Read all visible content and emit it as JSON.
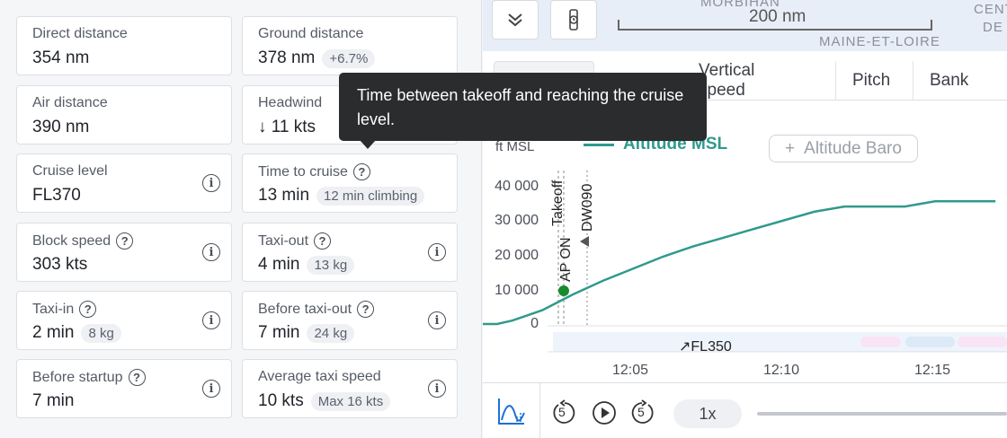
{
  "cards": {
    "direct_distance": {
      "label": "Direct distance",
      "value": "354 nm"
    },
    "ground_distance": {
      "label": "Ground distance",
      "value": "378 nm",
      "badge": "+6.7%"
    },
    "air_distance": {
      "label": "Air distance",
      "value": "390 nm"
    },
    "headwind": {
      "label": "Headwind",
      "value": "↓ 11 kts"
    },
    "cruise_level": {
      "label": "Cruise level",
      "value": "FL370"
    },
    "time_to_cruise": {
      "label": "Time to cruise",
      "value": "13 min",
      "badge": "12 min climbing"
    },
    "block_speed": {
      "label": "Block speed",
      "value": "303 kts"
    },
    "taxi_out": {
      "label": "Taxi-out",
      "value": "4 min",
      "badge": "13 kg"
    },
    "taxi_in": {
      "label": "Taxi-in",
      "value": "2 min",
      "badge": "8 kg"
    },
    "before_taxi_out": {
      "label": "Before taxi-out",
      "value": "7 min",
      "badge": "24 kg"
    },
    "before_startup": {
      "label": "Before startup",
      "value": "7 min"
    },
    "average_taxi_speed": {
      "label": "Average taxi speed",
      "value": "10 kts",
      "badge": "Max 16 kts"
    }
  },
  "tooltip": {
    "text": "Time between takeoff and reaching the cruise level."
  },
  "map": {
    "scale": "200 nm",
    "labels": [
      "MORBIHAN",
      "MAINE-ET-LOIRE",
      "CENT",
      "DE"
    ]
  },
  "tabs": [
    "",
    "Vertical speed",
    "Pitch",
    "Bank"
  ],
  "chart": {
    "y_title": "ft MSL",
    "legend_active": "Altitude MSL",
    "legend_inactive": "Altitude Baro",
    "events": [
      "Takeoff",
      "AP ON",
      "DW090"
    ],
    "annotation": "↗FL350",
    "yticks": [
      "40 000",
      "30 000",
      "20 000",
      "10 000",
      "0"
    ],
    "xticks": [
      "12:05",
      "12:10",
      "12:15"
    ],
    "line_color": "#2f9a8c"
  },
  "chart_data": {
    "type": "line",
    "title": "",
    "ylabel": "ft MSL",
    "xlabel": "",
    "ylim": [
      0,
      40000
    ],
    "series": [
      {
        "name": "Altitude MSL",
        "x": [
          "12:00",
          "12:00:30",
          "12:01",
          "12:01:30",
          "12:02",
          "12:03",
          "12:04",
          "12:05",
          "12:06",
          "12:07",
          "12:08",
          "12:09",
          "12:10",
          "12:11",
          "12:12",
          "12:13",
          "12:14",
          "12:15",
          "12:16",
          "12:17"
        ],
        "values": [
          0,
          0,
          1000,
          2500,
          4000,
          8500,
          12500,
          16000,
          19500,
          22500,
          25000,
          27500,
          30000,
          32500,
          34000,
          34000,
          34000,
          35500,
          35500,
          35500
        ]
      }
    ]
  },
  "player": {
    "rewind": "5",
    "forward": "5",
    "speed": "1x"
  }
}
